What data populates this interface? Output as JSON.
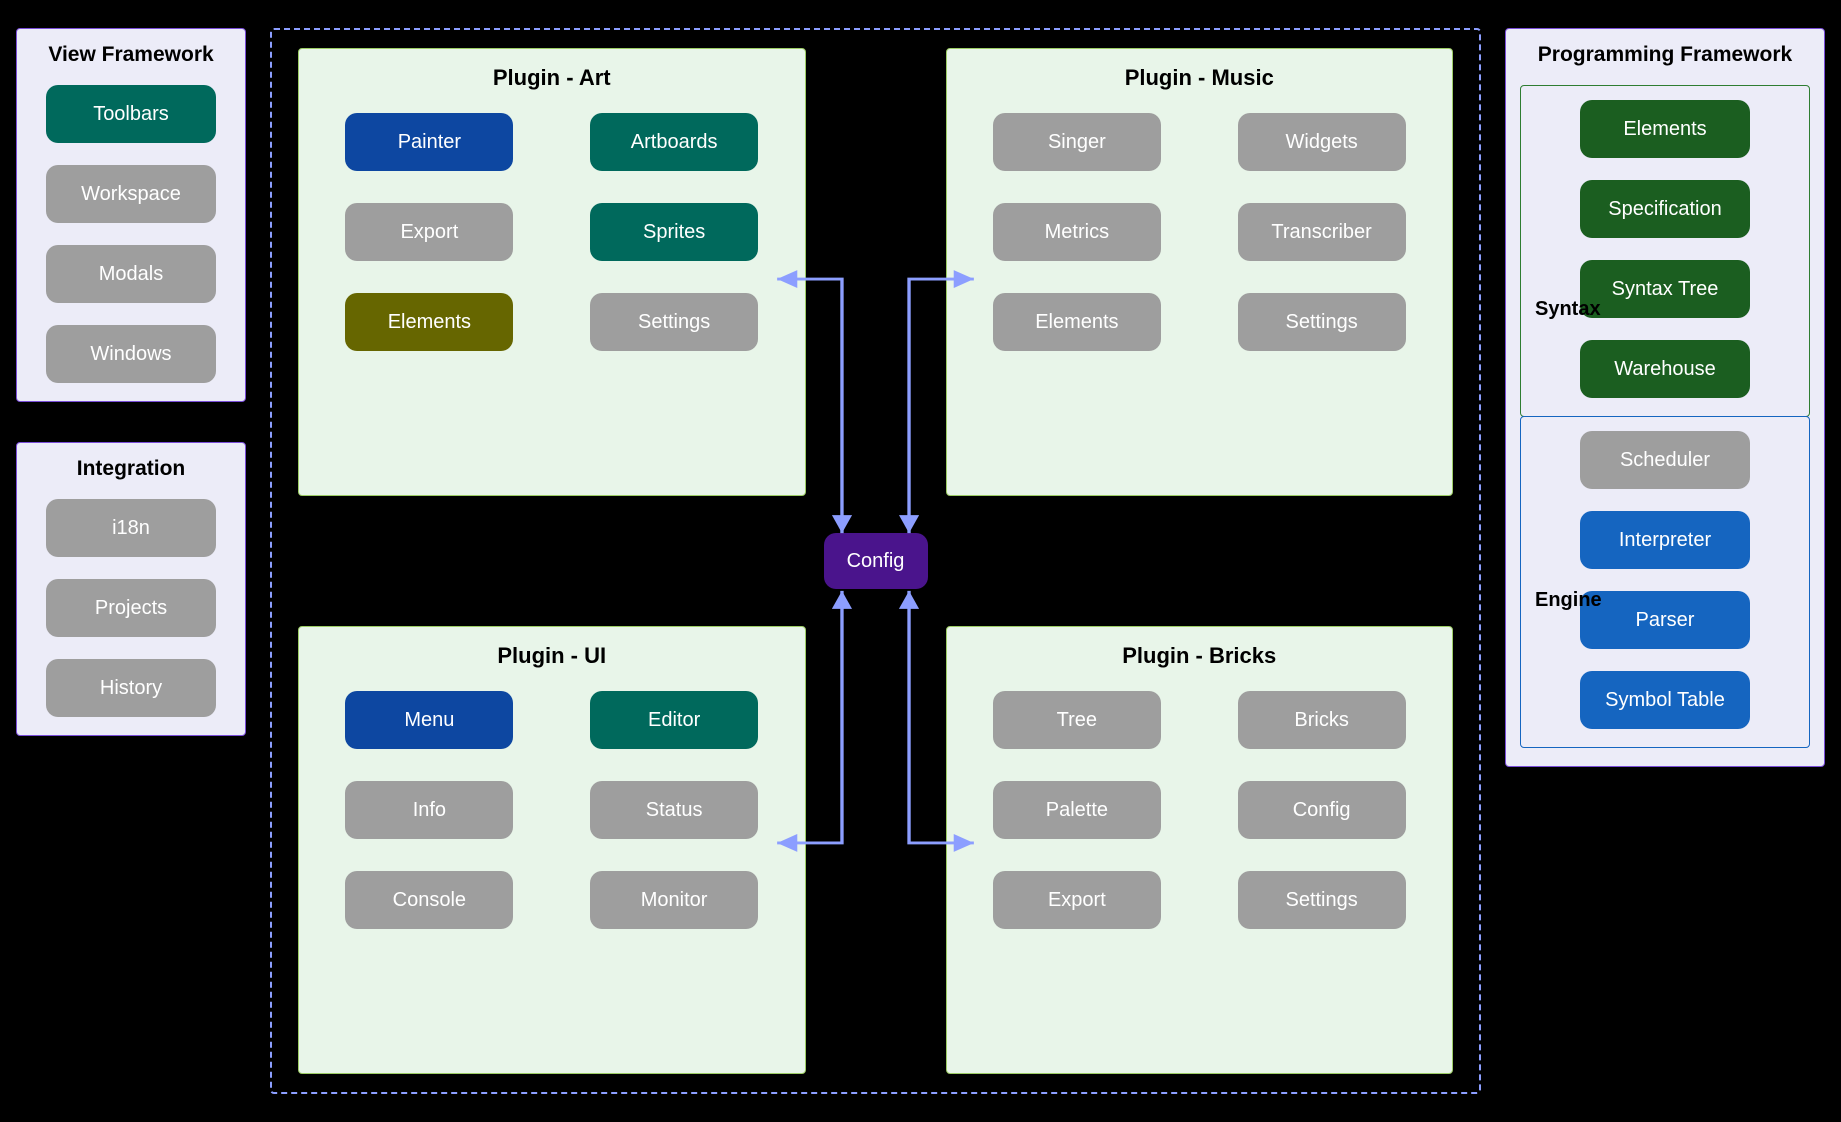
{
  "left": {
    "viewFramework": {
      "title": "View Framework",
      "items": [
        "Toolbars",
        "Workspace",
        "Modals",
        "Windows"
      ],
      "highlight": "Toolbars"
    },
    "integration": {
      "title": "Integration",
      "items": [
        "i18n",
        "Projects",
        "History"
      ]
    }
  },
  "center": {
    "config_label": "Config",
    "plugins": {
      "art": {
        "title": "Plugin - Art",
        "items": [
          {
            "label": "Painter",
            "color": "blue"
          },
          {
            "label": "Artboards",
            "color": "teal"
          },
          {
            "label": "Export",
            "color": "gray"
          },
          {
            "label": "Sprites",
            "color": "teal"
          },
          {
            "label": "Elements",
            "color": "olive"
          },
          {
            "label": "Settings",
            "color": "gray"
          }
        ]
      },
      "music": {
        "title": "Plugin - Music",
        "items": [
          {
            "label": "Singer",
            "color": "gray"
          },
          {
            "label": "Widgets",
            "color": "gray"
          },
          {
            "label": "Metrics",
            "color": "gray"
          },
          {
            "label": "Transcriber",
            "color": "gray"
          },
          {
            "label": "Elements",
            "color": "gray"
          },
          {
            "label": "Settings",
            "color": "gray"
          }
        ]
      },
      "ui": {
        "title": "Plugin - UI",
        "items": [
          {
            "label": "Menu",
            "color": "blue"
          },
          {
            "label": "Editor",
            "color": "teal"
          },
          {
            "label": "Info",
            "color": "gray"
          },
          {
            "label": "Status",
            "color": "gray"
          },
          {
            "label": "Console",
            "color": "gray"
          },
          {
            "label": "Monitor",
            "color": "gray"
          }
        ]
      },
      "bricks": {
        "title": "Plugin - Bricks",
        "items": [
          {
            "label": "Tree",
            "color": "gray"
          },
          {
            "label": "Bricks",
            "color": "gray"
          },
          {
            "label": "Palette",
            "color": "gray"
          },
          {
            "label": "Config",
            "color": "gray"
          },
          {
            "label": "Export",
            "color": "gray"
          },
          {
            "label": "Settings",
            "color": "gray"
          }
        ]
      }
    }
  },
  "right": {
    "title": "Programming Framework",
    "syntax": {
      "label": "Syntax",
      "items": [
        "Elements",
        "Specification",
        "Syntax Tree",
        "Warehouse"
      ]
    },
    "engine": {
      "label": "Engine",
      "items": [
        {
          "label": "Scheduler",
          "color": "gray"
        },
        {
          "label": "Interpreter",
          "color": "dblue"
        },
        {
          "label": "Parser",
          "color": "dblue"
        },
        {
          "label": "Symbol Table",
          "color": "dblue"
        }
      ]
    }
  },
  "arrow_color": "#8C9EFF"
}
